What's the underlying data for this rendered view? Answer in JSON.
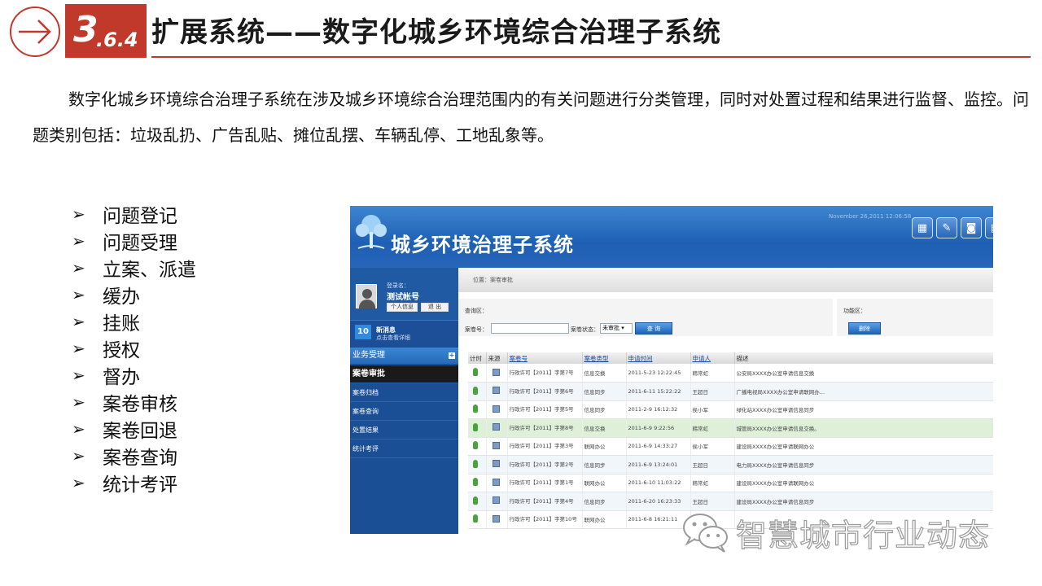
{
  "slide": {
    "section_major": "3",
    "section_minor": ".6.4",
    "title": "扩展系统——数字化城乡环境综合治理子系统",
    "intro": "数字化城乡环境综合治理子系统在涉及城乡环境综合治理范围内的有关问题进行分类管理，同时对处置过程和结果进行监督、监控。问题类别包括：垃圾乱扔、广告乱贴、摊位乱摆、车辆乱停、工地乱象等。",
    "bullet_glyph": "➢",
    "features": [
      "问题登记",
      "问题受理",
      "立案、派遣",
      "缓办",
      "挂账",
      "授权",
      "督办",
      "案卷审核",
      "案卷回退",
      "案卷查询",
      "统计考评"
    ],
    "accent_color": "#c0392b"
  },
  "app": {
    "title": "城乡环境治理子系统",
    "date": "November 26,2011 12:06:58",
    "header_color": "#1e5fb4",
    "toolbar_icons": [
      "calculator-icon",
      "notepad-icon",
      "camera-icon",
      "more-icon"
    ],
    "user": {
      "label": "登录名：",
      "name": "测试帐号",
      "profile_button": "个人信息",
      "logout_button": "退 出"
    },
    "messages": {
      "count": "10",
      "title": "新消息",
      "subtitle": "点击查看详细"
    },
    "sidebar": {
      "section": "业务受理",
      "items": [
        "案卷审批",
        "案卷归档",
        "案卷查询",
        "处置结果",
        "统计考评"
      ]
    },
    "breadcrumb": "位置：案卷审批",
    "search": {
      "title": "查询区：",
      "case_label": "案卷号：",
      "status_label": "案卷状态：",
      "status_value": "未审批",
      "query_button": "查 询"
    },
    "function_area": {
      "title": "功能区：",
      "delete_button": "删除"
    },
    "table": {
      "headers": [
        "计时",
        "来源",
        "案卷号",
        "案卷类型",
        "申请时间",
        "申请人",
        "描述"
      ],
      "rows": [
        {
          "case": "行政许可【2011】字第7号",
          "type": "信息交换",
          "time": "2011-5-23 12:22:45",
          "applicant": "韩常虹",
          "desc": "公安局XXXX办公室申请信息交换"
        },
        {
          "case": "行政许可【2011】字第6号",
          "type": "信息同步",
          "time": "2011-6-11 15:22:22",
          "applicant": "王超日",
          "desc": "广播电视局XXXX办公室申请联网办..."
        },
        {
          "case": "行政许可【2011】字第5号",
          "type": "信息同步",
          "time": "2011-2-9 16:12:32",
          "applicant": "侯小军",
          "desc": "绿化站XXXX办公室申请信息同步"
        },
        {
          "case": "行政许可【2011】字第8号",
          "type": "信息交换",
          "time": "2011-6-9 9:22:56",
          "applicant": "韩常虹",
          "desc": "城管局XXXX办公室申请信息交换。"
        },
        {
          "case": "行政许可【2011】字第3号",
          "type": "联网办公",
          "time": "2011-6-9 14:33:27",
          "applicant": "侯小军",
          "desc": "建设局XXXX办公室申请联网办公"
        },
        {
          "case": "行政许可【2011】字第2号",
          "type": "信息同步",
          "time": "2011-6-9 13:24:01",
          "applicant": "王超日",
          "desc": "电力局XXXX办公室申请信息同步"
        },
        {
          "case": "行政许可【2011】字第1号",
          "type": "联网办公",
          "time": "2011-6-10 11:03:22",
          "applicant": "韩常虹",
          "desc": "建设局XXXX办公室申请联网办公"
        },
        {
          "case": "行政许可【2011】字第4号",
          "type": "信息同步",
          "time": "2011-6-20 16:23:33",
          "applicant": "王超日",
          "desc": "建设局XXXX办公室申请信息同步"
        },
        {
          "case": "行政许可【2011】字第10号",
          "type": "联网办公",
          "time": "2011-6-8 16:21:11",
          "applicant": "",
          "desc": ""
        }
      ]
    }
  },
  "watermark": {
    "text": "智慧城市行业动态",
    "icon": "wechat-icon"
  }
}
